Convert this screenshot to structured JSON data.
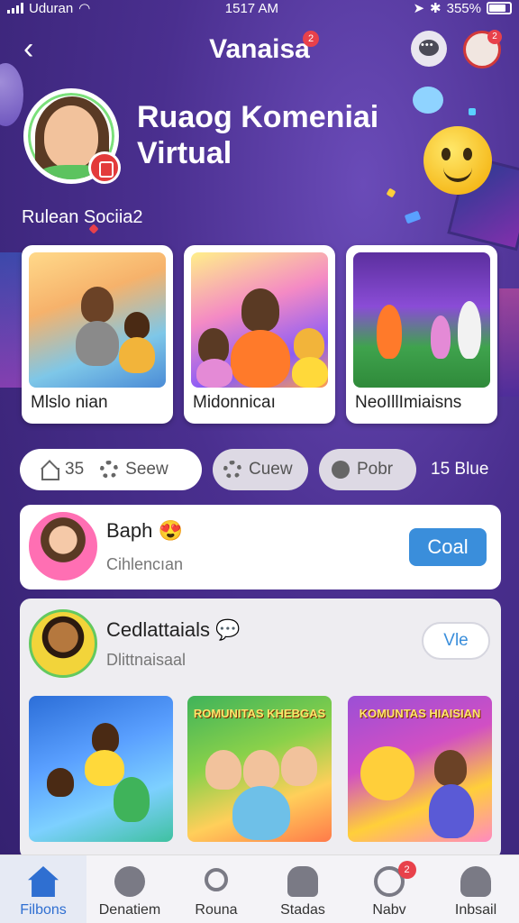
{
  "status_bar": {
    "carrier": "Uduran",
    "time": "1517 AM",
    "battery": "355%"
  },
  "header": {
    "title": "Vanaisa",
    "title_badge": "2",
    "notif_badge": "2"
  },
  "profile": {
    "title": "Ruaog Komeniai Virtual",
    "subtitle": "Rulean Sociia2"
  },
  "top_cards": [
    {
      "label": "Mlslo nian"
    },
    {
      "label": "Midonnicaı"
    },
    {
      "label": "NeoIllImiaisns"
    }
  ],
  "chips": {
    "chip1_count": "35",
    "chip1_label": "Seew",
    "chip2_label": "Cuew",
    "chip3_label": "Pobr",
    "count_label": "15 Blue"
  },
  "post1": {
    "name": "Baph",
    "subtitle": "Cihlencıan",
    "button": "Coal"
  },
  "post2": {
    "name": "Cedlattaials",
    "subtitle": "Dlittnaisaal",
    "button": "Vle",
    "images": [
      {
        "caption": ""
      },
      {
        "caption": "ROMUNITAS KHEBGAS"
      },
      {
        "caption": "KOMUNTAS HIAISIAN"
      }
    ]
  },
  "bottom_nav": [
    {
      "label": "Filbons",
      "icon": "home-icon"
    },
    {
      "label": "Denatiem",
      "icon": "check-icon"
    },
    {
      "label": "Rouna",
      "icon": "search-icon"
    },
    {
      "label": "Stadas",
      "icon": "stats-icon"
    },
    {
      "label": "Nabv",
      "icon": "bell-icon",
      "badge": "2"
    },
    {
      "label": "Inbsail",
      "icon": "user-icon"
    }
  ],
  "colors": {
    "background": "#4a2f8f",
    "accent": "#3a8edb",
    "badge": "#e8414b",
    "active_nav": "#2f6fd1"
  }
}
